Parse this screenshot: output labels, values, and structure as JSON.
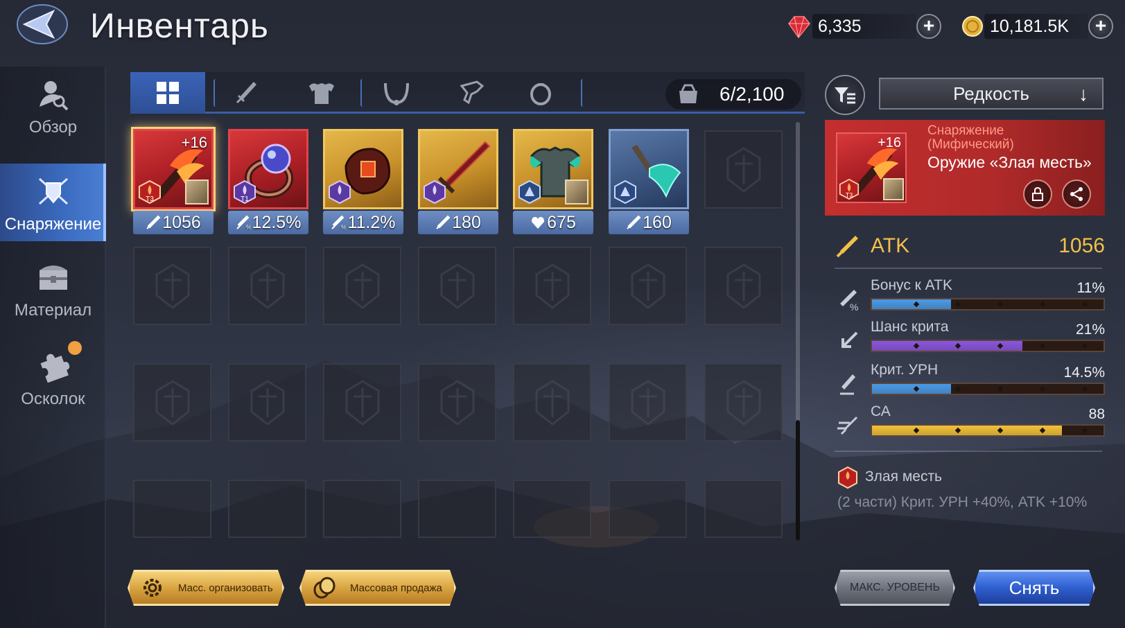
{
  "header": {
    "title": "Инвентарь",
    "gems": {
      "amount": "6,335",
      "icon": "red-gem-icon"
    },
    "gold": {
      "amount": "10,181.5K",
      "icon": "gold-coin-icon"
    }
  },
  "sidebar": {
    "items": [
      {
        "label": "Обзор",
        "icon": "character-search-icon",
        "active": false
      },
      {
        "label": "Снаряжение",
        "icon": "shield-swords-icon",
        "active": true
      },
      {
        "label": "Материал",
        "icon": "chest-icon",
        "active": false
      },
      {
        "label": "Осколок",
        "icon": "puzzle-piece-icon",
        "active": false,
        "notification": true
      }
    ]
  },
  "tabs": [
    {
      "name": "all",
      "icon": "grid-icon",
      "active": true
    },
    {
      "name": "weapon",
      "icon": "sword-icon",
      "active": false
    },
    {
      "name": "armor",
      "icon": "armor-icon",
      "active": false
    },
    {
      "name": "necklace",
      "icon": "necklace-icon",
      "active": false
    },
    {
      "name": "gloves",
      "icon": "gloves-icon",
      "active": false
    },
    {
      "name": "ring",
      "icon": "ring-icon",
      "active": false
    }
  ],
  "capacity": {
    "value": "6/2,100",
    "icon": "bag-icon"
  },
  "items": [
    {
      "name": "Оружие «Злая месть»",
      "rarity": "red",
      "level": "+16",
      "tier": "T3",
      "stat": "1056",
      "stat_icon": "attack-icon",
      "selected": true,
      "portrait": true
    },
    {
      "name": "ring",
      "rarity": "red",
      "level": "",
      "tier": "T1",
      "stat": "12.5%",
      "stat_icon": "attack-bonus-icon",
      "selected": false,
      "portrait": false
    },
    {
      "name": "bracer",
      "rarity": "gold",
      "level": "",
      "tier": "",
      "stat": "11.2%",
      "stat_icon": "attack-bonus-icon",
      "selected": false,
      "portrait": false
    },
    {
      "name": "sword",
      "rarity": "gold",
      "level": "",
      "tier": "",
      "stat": "180",
      "stat_icon": "attack-icon",
      "selected": false,
      "portrait": false
    },
    {
      "name": "armor",
      "rarity": "gold",
      "level": "",
      "tier": "",
      "stat": "675",
      "stat_icon": "heart-icon",
      "selected": false,
      "portrait": true
    },
    {
      "name": "axe",
      "rarity": "blue",
      "level": "",
      "tier": "",
      "stat": "160",
      "stat_icon": "attack-icon",
      "selected": false,
      "portrait": false
    }
  ],
  "filter": {
    "label": "Редкость",
    "sort_icon": "arrow-down-icon"
  },
  "detail": {
    "category": "Снаряжение (Мифический)",
    "name": "Оружие «Злая месть»",
    "level": "+16",
    "tier": "T3",
    "main_stat": {
      "label": "ATK",
      "value": "1056"
    },
    "sub_stats": [
      {
        "label": "Бонус к ATK",
        "value": "11%",
        "fill": 0.34,
        "color": "#4a9be8"
      },
      {
        "label": "Шанс крита",
        "value": "21%",
        "fill": 0.65,
        "color": "#8a56e0"
      },
      {
        "label": "Крит. УРН",
        "value": "14.5%",
        "fill": 0.34,
        "color": "#4a9be8"
      },
      {
        "label": "СА",
        "value": "88",
        "fill": 0.82,
        "color": "#f2c23a"
      }
    ],
    "set": {
      "name": "Злая месть",
      "description": "(2 части) Крит. УРН +40%, ATK +10%"
    }
  },
  "buttons": {
    "mass_organize": "Масс. организовать",
    "mass_sell": "Массовая продажа",
    "max_level": "МАКС. УРОВЕНЬ",
    "unequip": "Снять"
  },
  "colors": {
    "accent_blue": "#3a63b8",
    "gold": "#f3c04a",
    "mythic_red": "#c42e2e"
  }
}
